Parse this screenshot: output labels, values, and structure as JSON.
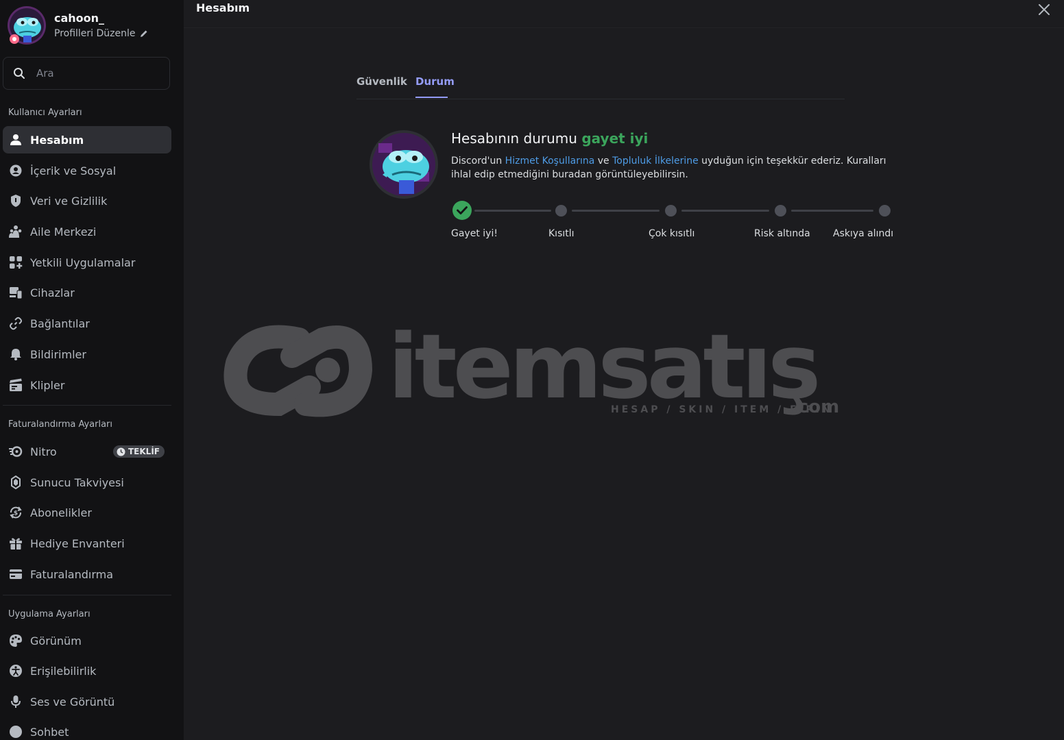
{
  "sidebar": {
    "profile": {
      "name": "cahoon_",
      "edit_label": "Profilleri Düzenle"
    },
    "search": {
      "placeholder": "Ara"
    },
    "sections": [
      {
        "title": "Kullanıcı Ayarları",
        "items": [
          {
            "label": "Hesabım",
            "icon": "user-icon",
            "active": true
          },
          {
            "label": "İçerik ve Sosyal",
            "icon": "content-social-icon"
          },
          {
            "label": "Veri ve Gizlilik",
            "icon": "shield-icon"
          },
          {
            "label": "Aile Merkezi",
            "icon": "family-icon"
          },
          {
            "label": "Yetkili Uygulamalar",
            "icon": "apps-icon"
          },
          {
            "label": "Cihazlar",
            "icon": "devices-icon"
          },
          {
            "label": "Bağlantılar",
            "icon": "link-icon"
          },
          {
            "label": "Bildirimler",
            "icon": "bell-icon"
          },
          {
            "label": "Klipler",
            "icon": "clapperboard-icon"
          }
        ]
      },
      {
        "title": "Faturalandırma Ayarları",
        "items": [
          {
            "label": "Nitro",
            "icon": "nitro-icon",
            "badge": "TEKLİF"
          },
          {
            "label": "Sunucu Takviyesi",
            "icon": "boost-icon"
          },
          {
            "label": "Abonelikler",
            "icon": "subscription-icon"
          },
          {
            "label": "Hediye Envanteri",
            "icon": "gift-icon"
          },
          {
            "label": "Faturalandırma",
            "icon": "credit-card-icon"
          }
        ]
      },
      {
        "title": "Uygulama Ayarları",
        "items": [
          {
            "label": "Görünüm",
            "icon": "palette-icon"
          },
          {
            "label": "Erişilebilirlik",
            "icon": "accessibility-icon"
          },
          {
            "label": "Ses ve Görüntü",
            "icon": "microphone-icon"
          },
          {
            "label": "Sohbet",
            "icon": "chat-icon"
          }
        ]
      }
    ]
  },
  "main": {
    "title": "Hesabım",
    "tabs": [
      {
        "label": "Güvenlik",
        "active": false
      },
      {
        "label": "Durum",
        "active": true
      }
    ],
    "status": {
      "heading_prefix": "Hesabının durumu",
      "heading_value": "gayet iyi",
      "desc_part1": "Discord'un",
      "link1": "Hizmet Koşullarına",
      "desc_part2": "ve",
      "link2": "Topluluk İlkelerine",
      "desc_part3": "uyduğun için teşekkür ederiz. Kuralları ihlal edip etmediğini buradan görüntüleyebilirsin.",
      "steps": [
        "Gayet iyi!",
        "Kısıtlı",
        "Çok kısıtlı",
        "Risk altında",
        "Askıya alındı"
      ],
      "current_step": 0
    },
    "watermark": {
      "brand": "itemsatış",
      "tagline": "HESAP / SKIN / ITEM / E-PIN",
      "suffix": ".com"
    }
  },
  "colors": {
    "accent": "#949cf7",
    "good": "#3ba55c",
    "link": "#4e9ce6",
    "sidebar_bg": "#121214",
    "main_bg": "#1c1c1f"
  }
}
